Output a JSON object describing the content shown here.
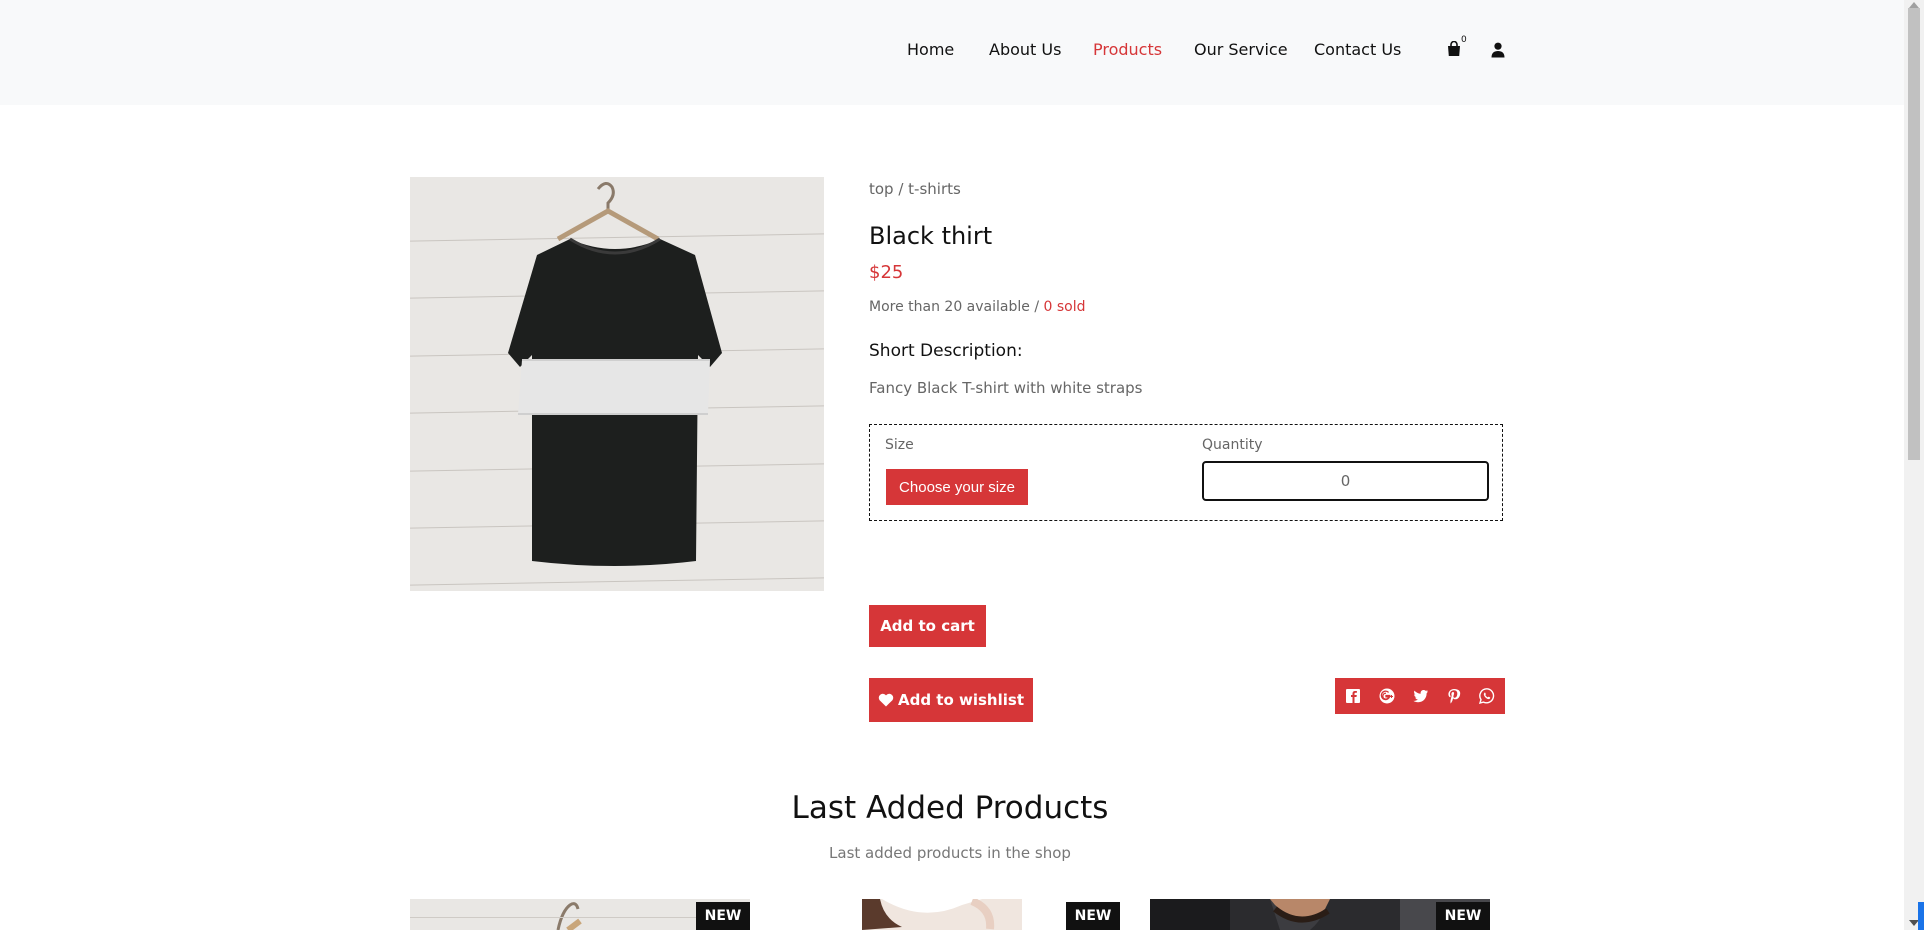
{
  "nav": {
    "home": "Home",
    "about": "About Us",
    "products": "Products",
    "service": "Our Service",
    "contact": "Contact Us",
    "cart_count": "0",
    "active_color": "#d63638"
  },
  "icons": {
    "cart": "shopping-bag-icon",
    "user": "user-icon"
  },
  "product": {
    "breadcrumb": "top / t-shirts",
    "title": "Black thirt",
    "price": "$25",
    "availability": "More than 20 available /",
    "sold": "0 sold",
    "description_heading": "Short Description:",
    "description": "Fancy Black T-shirt with white straps",
    "size_label": "Size",
    "size_button": "Choose your size",
    "quantity_label": "Quantity",
    "quantity_value": "0",
    "add_to_cart": "Add to cart",
    "add_to_wishlist": "Add to wishlist"
  },
  "share": [
    "facebook-icon",
    "google-plus-icon",
    "twitter-icon",
    "pinterest-icon",
    "whatsapp-icon"
  ],
  "last_added": {
    "title": "Last Added Products",
    "subtitle": "Last added products in the shop",
    "badges": [
      "NEW",
      "NEW",
      "NEW"
    ]
  },
  "colors": {
    "accent": "#d63638",
    "header_bg": "#f8f9fa",
    "badge_bg": "#111111"
  }
}
